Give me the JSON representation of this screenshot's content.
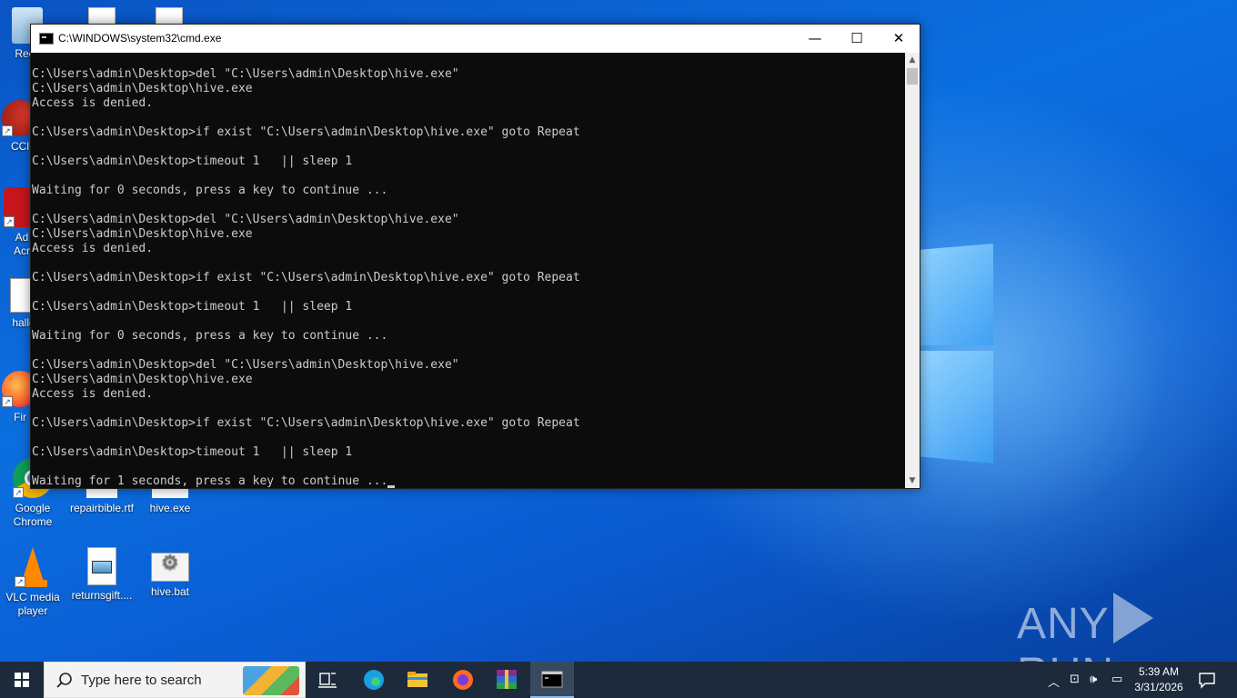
{
  "desktop": {
    "icons": [
      {
        "label": "Recy"
      },
      {
        "label": "CCl"
      },
      {
        "label": "Ad\nAcr"
      },
      {
        "label": "halld"
      },
      {
        "label": "Fir"
      },
      {
        "label": "Google\nChrome"
      },
      {
        "label": "repairbible.rtf"
      },
      {
        "label": "hive.exe"
      },
      {
        "label": "VLC media\nplayer"
      },
      {
        "label": "returnsgift...."
      },
      {
        "label": "hive.bat"
      }
    ]
  },
  "cmd_window": {
    "title": "C:\\WINDOWS\\system32\\cmd.exe",
    "minimize_glyph": "—",
    "maximize_glyph": "☐",
    "close_glyph": "✕",
    "output": "C:\\Users\\admin\\Desktop>del \"C:\\Users\\admin\\Desktop\\hive.exe\"\nC:\\Users\\admin\\Desktop\\hive.exe\nAccess is denied.\n\nC:\\Users\\admin\\Desktop>if exist \"C:\\Users\\admin\\Desktop\\hive.exe\" goto Repeat\n\nC:\\Users\\admin\\Desktop>timeout 1   || sleep 1\n\nWaiting for 0 seconds, press a key to continue ...\n\nC:\\Users\\admin\\Desktop>del \"C:\\Users\\admin\\Desktop\\hive.exe\"\nC:\\Users\\admin\\Desktop\\hive.exe\nAccess is denied.\n\nC:\\Users\\admin\\Desktop>if exist \"C:\\Users\\admin\\Desktop\\hive.exe\" goto Repeat\n\nC:\\Users\\admin\\Desktop>timeout 1   || sleep 1\n\nWaiting for 0 seconds, press a key to continue ...\n\nC:\\Users\\admin\\Desktop>del \"C:\\Users\\admin\\Desktop\\hive.exe\"\nC:\\Users\\admin\\Desktop\\hive.exe\nAccess is denied.\n\nC:\\Users\\admin\\Desktop>if exist \"C:\\Users\\admin\\Desktop\\hive.exe\" goto Repeat\n\nC:\\Users\\admin\\Desktop>timeout 1   || sleep 1\n\nWaiting for 1 seconds, press a key to continue ..."
  },
  "taskbar": {
    "search_placeholder": "Type here to search",
    "time": "5:39 AM",
    "date": "3/31/2026",
    "apps": [
      "task-view",
      "edge",
      "file-explorer",
      "firefox",
      "winrar",
      "cmd"
    ]
  },
  "watermark": {
    "left": "ANY",
    "right": "RUN"
  },
  "colors": {
    "console_bg": "#0c0c0c",
    "console_fg": "#cccccc",
    "taskbar": "#1c2a3c",
    "desktop": "#0b5fcc"
  }
}
